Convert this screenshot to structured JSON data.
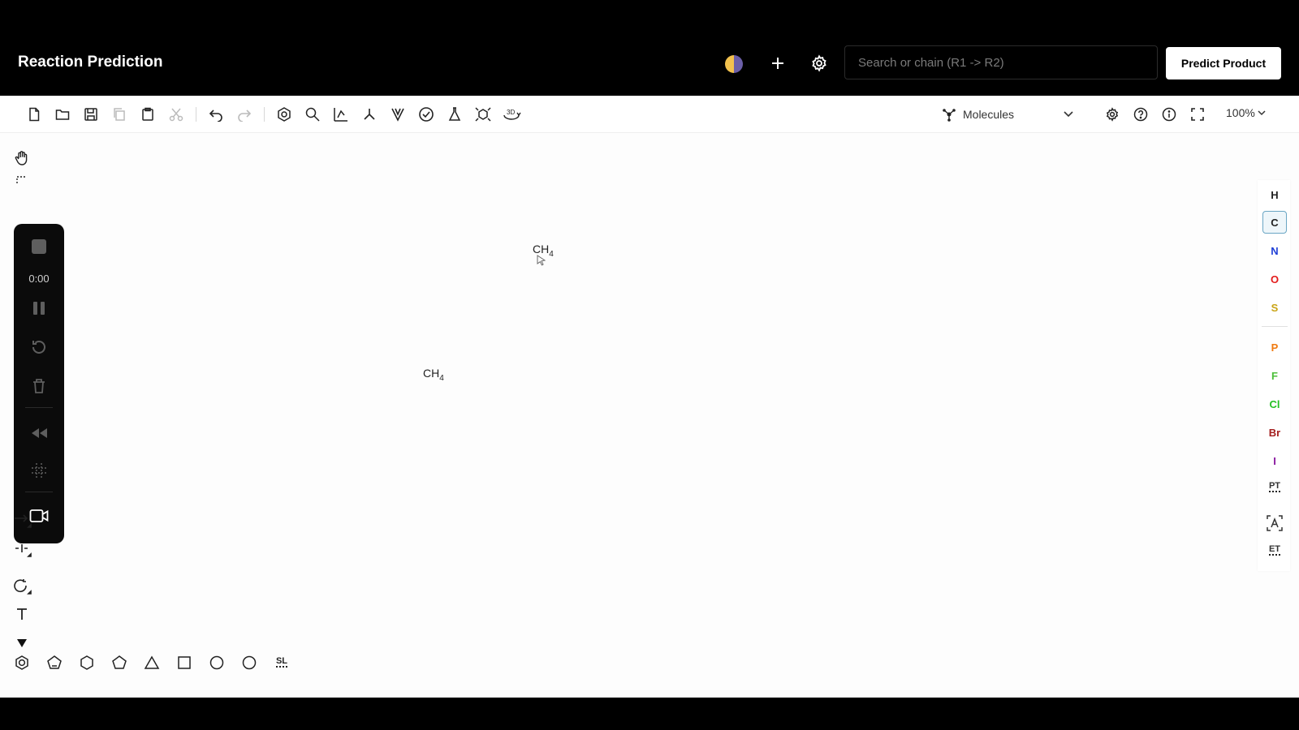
{
  "header": {
    "title": "Reaction Prediction",
    "search_placeholder": "Search or chain (R1 -> R2)",
    "search_value": "",
    "predict_label": "Predict Product"
  },
  "toolbar": {
    "mode_label": "Molecules",
    "zoom_label": "100%"
  },
  "recorder": {
    "time": "0:00"
  },
  "canvas": {
    "molecules": [
      {
        "base": "CH",
        "sub": "4"
      },
      {
        "base": "CH",
        "sub": "4"
      }
    ]
  },
  "elements": {
    "items": [
      {
        "symbol": "H",
        "color": "#222222"
      },
      {
        "symbol": "C",
        "color": "#222222"
      },
      {
        "symbol": "N",
        "color": "#1f3fd6"
      },
      {
        "symbol": "O",
        "color": "#e31b1b"
      },
      {
        "symbol": "S",
        "color": "#c9a415"
      },
      {
        "symbol": "P",
        "color": "#f07a10"
      },
      {
        "symbol": "F",
        "color": "#4cbf3a"
      },
      {
        "symbol": "Cl",
        "color": "#24c024"
      },
      {
        "symbol": "Br",
        "color": "#a41e1e"
      },
      {
        "symbol": "I",
        "color": "#8a1aa0"
      }
    ],
    "periodic_table_label": "PT",
    "extended_table_label": "ET"
  },
  "shapes": {
    "sl_label": "SL"
  },
  "colors": {
    "accent": "#6aa6c4",
    "header_bg": "#000000"
  }
}
